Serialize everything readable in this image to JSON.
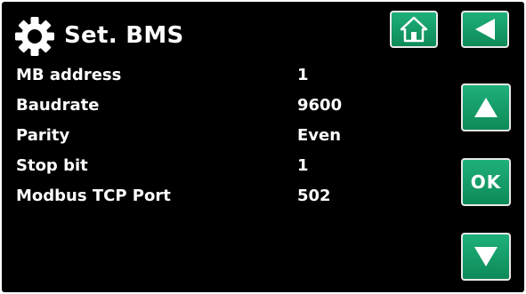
{
  "header": {
    "title": "Set. BMS",
    "icon": "gear-icon"
  },
  "params": [
    {
      "label": "MB address",
      "value": "1"
    },
    {
      "label": "Baudrate",
      "value": "9600"
    },
    {
      "label": "Parity",
      "value": "Even"
    },
    {
      "label": "Stop bit",
      "value": "1"
    },
    {
      "label": "Modbus TCP Port",
      "value": "502"
    }
  ],
  "buttons": {
    "home_icon": "home-icon",
    "back_icon": "back-arrow-icon",
    "up_icon": "up-arrow-icon",
    "ok_label": "OK",
    "down_icon": "down-arrow-icon"
  },
  "colors": {
    "background": "#000000",
    "text": "#ffffff",
    "button_green": "#12995f",
    "button_border": "#e8e8e8"
  }
}
